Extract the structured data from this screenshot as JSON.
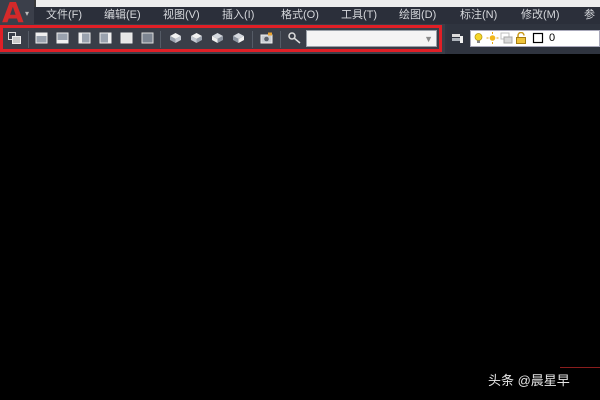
{
  "menubar": {
    "items": [
      "文件(F)",
      "编辑(E)",
      "视图(V)",
      "插入(I)",
      "格式(O)",
      "工具(T)",
      "绘图(D)",
      "标注(N)",
      "修改(M)",
      "参"
    ]
  },
  "view_toolbar": {
    "icons": [
      "named-views-icon",
      "top-view-icon",
      "bottom-view-icon",
      "left-view-icon",
      "right-view-icon",
      "front-view-icon",
      "back-view-icon",
      "sw-iso-view-icon",
      "se-iso-view-icon",
      "ne-iso-view-icon",
      "nw-iso-view-icon",
      "camera-icon",
      "ucs-icon"
    ],
    "view_combo_value": ""
  },
  "layer_toolbar": {
    "layer_name": "0",
    "icons": [
      "layer-manager-icon",
      "lightbulb-icon",
      "sun-icon",
      "freeze-viewport-icon",
      "lock-icon",
      "color-swatch-icon"
    ]
  },
  "watermark": "头条 @晨星早",
  "colors": {
    "highlight": "#e01f26",
    "menubar_bg": "#2b2f3a",
    "toolbar_bg": "#3a3e48",
    "canvas_bg": "#000000",
    "logo_red": "#d42a2a"
  }
}
